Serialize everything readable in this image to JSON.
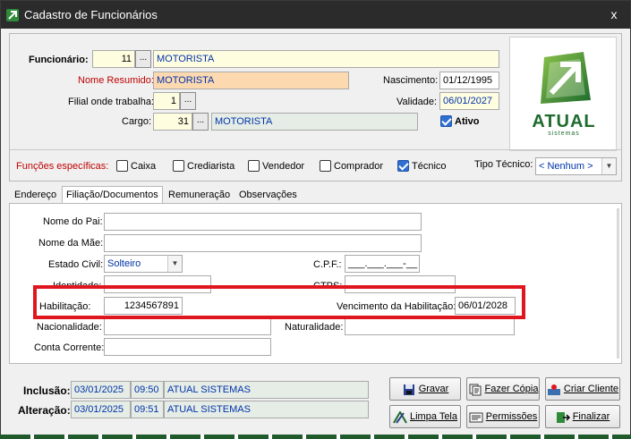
{
  "window": {
    "title": "Cadastro de Funcionários",
    "close_glyph": "x"
  },
  "header": {
    "funcionario": {
      "label": "Funcionário:",
      "code": "11",
      "name": "MOTORISTA"
    },
    "nome_resumido": {
      "label": "Nome Resumido:",
      "value": "MOTORISTA"
    },
    "nascimento": {
      "label": "Nascimento:",
      "value": "01/12/1995"
    },
    "filial": {
      "label": "Filial onde trabalha:",
      "value": "1"
    },
    "validade": {
      "label": "Validade:",
      "value": "06/01/2027"
    },
    "cargo": {
      "label": "Cargo:",
      "code": "31",
      "name": "MOTORISTA"
    },
    "ativo": {
      "label": "Ativo",
      "checked": true
    },
    "ellipsis": "..."
  },
  "logo": {
    "brand": "ATUAL",
    "sub": "sistemas"
  },
  "funcoes": {
    "label": "Funções específicas:",
    "items": [
      {
        "label": "Caixa",
        "checked": false
      },
      {
        "label": "Crediarista",
        "checked": false
      },
      {
        "label": "Vendedor",
        "checked": false
      },
      {
        "label": "Comprador",
        "checked": false
      },
      {
        "label": "Técnico",
        "checked": true
      }
    ],
    "tipo_tecnico": {
      "label": "Tipo Técnico:",
      "value": "< Nenhum >"
    }
  },
  "tabs": [
    "Endereço",
    "Filiação/Documentos",
    "Remuneração",
    "Observações"
  ],
  "doc": {
    "nome_pai": {
      "label": "Nome do Pai:",
      "value": ""
    },
    "nome_mae": {
      "label": "Nome da Mãe:",
      "value": ""
    },
    "estado_civil": {
      "label": "Estado Civil:",
      "value": "Solteiro"
    },
    "cpf": {
      "label": "C.P.F.:",
      "value": "___.___.___-__"
    },
    "identidade": {
      "label": "Identidade:",
      "value": ""
    },
    "ctps": {
      "label": "CTPS:",
      "value": ""
    },
    "habilitacao": {
      "label": "Habilitação:",
      "value": "1234567891"
    },
    "vencimento": {
      "label": "Vencimento da Habilitação:",
      "value": "06/01/2028"
    },
    "nacionalidade": {
      "label": "Nacionalidade:",
      "value": ""
    },
    "naturalidade": {
      "label": "Naturalidade:",
      "value": ""
    },
    "conta_corrente": {
      "label": "Conta Corrente:",
      "value": ""
    }
  },
  "footer": {
    "inclusao": {
      "label": "Inclusão:",
      "date": "03/01/2025",
      "time": "09:50",
      "user": "ATUAL SISTEMAS"
    },
    "alteracao": {
      "label": "Alteração:",
      "date": "03/01/2025",
      "time": "09:51",
      "user": "ATUAL SISTEMAS"
    }
  },
  "buttons": {
    "gravar": "Gravar",
    "fazer_copia": "Fazer Cópia",
    "criar_cliente": "Criar Cliente",
    "limpa_tela": "Limpa Tela",
    "permissoes": "Permissões",
    "finalizar": "Finalizar"
  },
  "colors": {
    "highlight": "#e0161f",
    "brand": "#1e6b2e",
    "title_bar": "#2b2b2b"
  }
}
